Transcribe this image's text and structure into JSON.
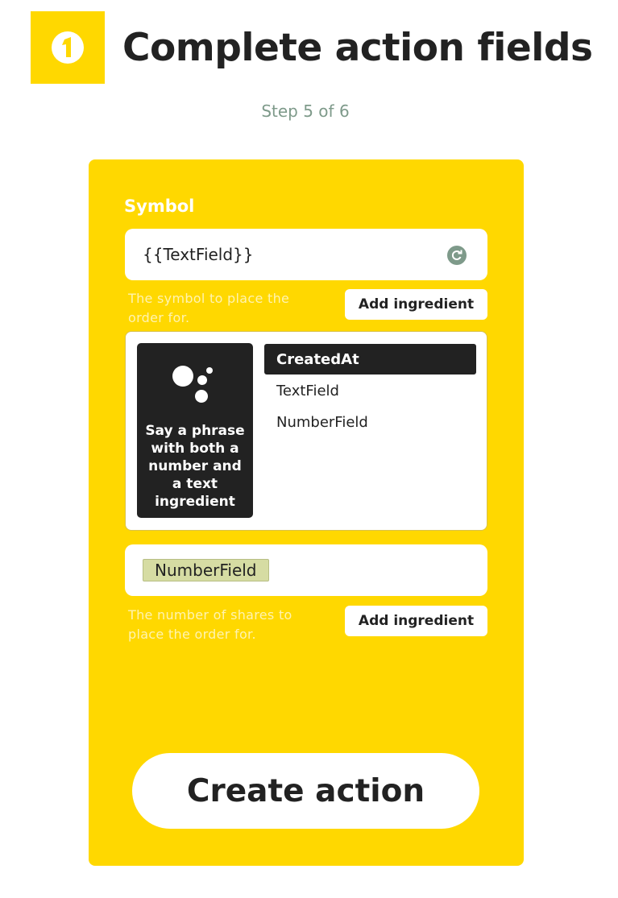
{
  "header": {
    "title": "Complete action fields",
    "step": "Step 5 of 6",
    "icon": "service-logo-icon",
    "accent_color": "#ffd800"
  },
  "fields": {
    "symbol": {
      "label": "Symbol",
      "value": "{{TextField}}",
      "help": "The symbol to place the order for.",
      "add_ingredient_label": "Add ingredient"
    },
    "quantity": {
      "value_token": "NumberField",
      "help": "The number of shares to place the order for.",
      "add_ingredient_label": "Add ingredient"
    }
  },
  "ingredient_dropdown": {
    "trigger_text": "Say a phrase with both a number and a text ingredient",
    "trigger_icon": "google-assistant-icon",
    "items": [
      {
        "label": "CreatedAt",
        "selected": true
      },
      {
        "label": "TextField",
        "selected": false
      },
      {
        "label": "NumberField",
        "selected": false
      }
    ]
  },
  "create_action_label": "Create action"
}
